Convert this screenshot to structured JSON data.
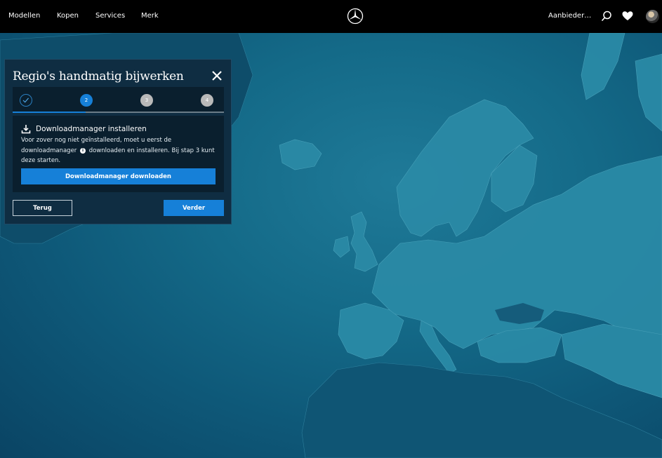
{
  "nav": {
    "links": [
      "Modellen",
      "Kopen",
      "Services",
      "Merk"
    ],
    "right_text": "Aanbieder…",
    "icons": [
      "mercedes-star-logo",
      "search-icon",
      "heart-icon",
      "avatar"
    ]
  },
  "dialog": {
    "title": "Regio's handmatig bijwerken",
    "close_icon": "close-icon",
    "steps": [
      {
        "label": "",
        "state": "done"
      },
      {
        "label": "2",
        "state": "active"
      },
      {
        "label": "3",
        "state": "todo"
      },
      {
        "label": "4",
        "state": "todo"
      }
    ],
    "content": {
      "icon": "download-icon",
      "heading": "Downloadmanager installeren",
      "text_part1": "Voor zover nog niet geïnstalleerd, moet u eerst de downloadmanager",
      "info_icon": "i",
      "text_part2": "downloaden en installeren. Bij stap 3 kunt deze starten.",
      "download_button": "Downloadmanager downloaden"
    },
    "back_button": "Terug",
    "next_button": "Verder"
  },
  "colors": {
    "accent": "#1680d8",
    "nav_bg": "#000000",
    "dialog_bg": "#0f2d42",
    "land": "#2a8aa6",
    "sea": "#146a88"
  }
}
